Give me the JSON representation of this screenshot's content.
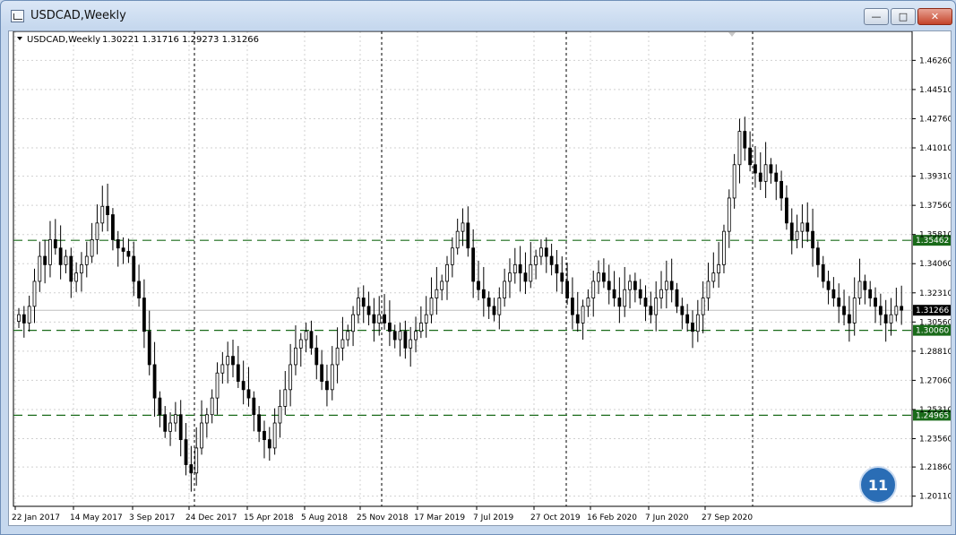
{
  "window": {
    "title": "USDCAD,Weekly",
    "buttons": {
      "minimize": "—",
      "maximize": "□",
      "close": "✕"
    }
  },
  "chart_data": {
    "type": "candlestick",
    "header": {
      "symbol": "USDCAD,Weekly",
      "ohlc": "1.30221 1.31716 1.29273 1.31266"
    },
    "ylim": [
      1.195,
      1.48
    ],
    "y_ticks": [
      "1.46260",
      "1.44510",
      "1.42760",
      "1.41010",
      "1.39310",
      "1.37560",
      "1.35810",
      "1.34060",
      "1.32310",
      "1.30560",
      "1.28810",
      "1.27060",
      "1.25310",
      "1.23560",
      "1.21860",
      "1.20110"
    ],
    "y_tick_values": [
      1.4626,
      1.4451,
      1.4276,
      1.4101,
      1.3931,
      1.3756,
      1.3581,
      1.3406,
      1.3231,
      1.3056,
      1.2881,
      1.2706,
      1.2531,
      1.2356,
      1.2186,
      1.2011
    ],
    "x_labels": [
      "22 Jan 2017",
      "14 May 2017",
      "3 Sep 2017",
      "24 Dec 2017",
      "15 Apr 2018",
      "5 Aug 2018",
      "25 Nov 2018",
      "17 Mar 2019",
      "7 Jul 2019",
      "27 Oct 2019",
      "16 Feb 2020",
      "7 Jun 2020",
      "27 Sep 2020"
    ],
    "horizontal_levels": [
      {
        "value": 1.35462,
        "label": "1.35462",
        "color": "#1a6b1a"
      },
      {
        "value": 1.3006,
        "label": "1.30060",
        "color": "#1a6b1a"
      },
      {
        "value": 1.24965,
        "label": "1.24965",
        "color": "#1a6b1a"
      }
    ],
    "current_price": {
      "value": 1.31266,
      "label": "1.31266"
    },
    "period_separators": [
      "24 Dec 2017",
      "25 Nov 2018",
      "27 Oct 2019",
      "27 Sep 2020"
    ],
    "grid": true,
    "candle_color": "#000000",
    "background": "#ffffff",
    "weekly_close": [
      1.31,
      1.305,
      1.315,
      1.33,
      1.345,
      1.34,
      1.355,
      1.35,
      1.34,
      1.345,
      1.33,
      1.335,
      1.34,
      1.345,
      1.355,
      1.365,
      1.375,
      1.37,
      1.355,
      1.35,
      1.348,
      1.345,
      1.33,
      1.32,
      1.3,
      1.28,
      1.26,
      1.25,
      1.24,
      1.245,
      1.25,
      1.235,
      1.22,
      1.215,
      1.23,
      1.245,
      1.25,
      1.26,
      1.275,
      1.28,
      1.285,
      1.28,
      1.27,
      1.265,
      1.26,
      1.25,
      1.24,
      1.235,
      1.23,
      1.245,
      1.255,
      1.265,
      1.28,
      1.29,
      1.295,
      1.3,
      1.29,
      1.28,
      1.27,
      1.265,
      1.28,
      1.29,
      1.295,
      1.3,
      1.31,
      1.32,
      1.315,
      1.31,
      1.305,
      1.31,
      1.305,
      1.3,
      1.295,
      1.3,
      1.29,
      1.295,
      1.3,
      1.305,
      1.31,
      1.32,
      1.325,
      1.33,
      1.34,
      1.35,
      1.36,
      1.365,
      1.35,
      1.33,
      1.325,
      1.32,
      1.315,
      1.31,
      1.32,
      1.33,
      1.335,
      1.34,
      1.335,
      1.33,
      1.34,
      1.345,
      1.35,
      1.345,
      1.34,
      1.335,
      1.33,
      1.32,
      1.31,
      1.305,
      1.315,
      1.32,
      1.33,
      1.335,
      1.33,
      1.325,
      1.32,
      1.315,
      1.325,
      1.33,
      1.325,
      1.32,
      1.315,
      1.31,
      1.32,
      1.325,
      1.33,
      1.325,
      1.315,
      1.31,
      1.305,
      1.3,
      1.31,
      1.32,
      1.33,
      1.335,
      1.34,
      1.36,
      1.38,
      1.4,
      1.42,
      1.41,
      1.4,
      1.395,
      1.39,
      1.4,
      1.395,
      1.39,
      1.38,
      1.365,
      1.355,
      1.36,
      1.365,
      1.36,
      1.35,
      1.34,
      1.33,
      1.325,
      1.32,
      1.315,
      1.31,
      1.305,
      1.32,
      1.33,
      1.325,
      1.32,
      1.315,
      1.31,
      1.305,
      1.31,
      1.315,
      1.3127
    ]
  },
  "badge": {
    "label": "11",
    "color": "#2a6db5"
  }
}
